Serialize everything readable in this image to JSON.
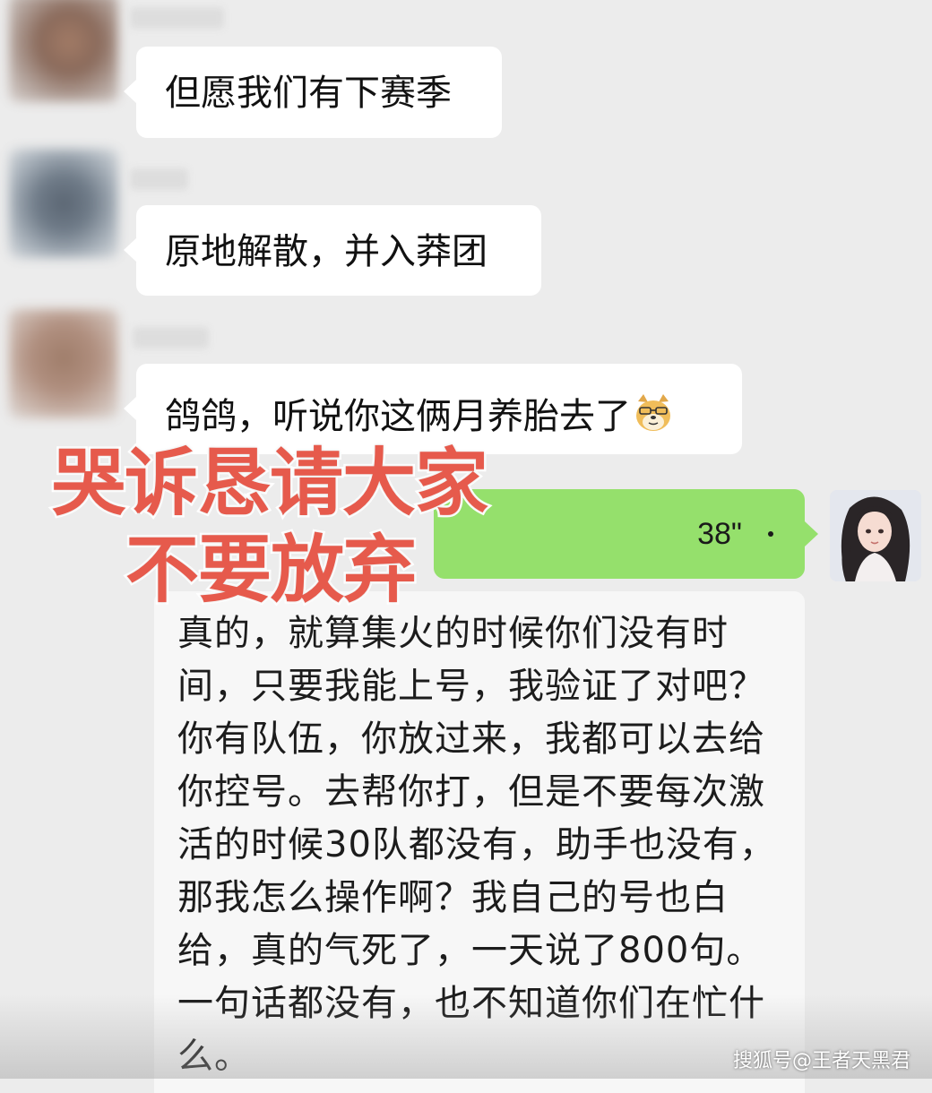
{
  "messages": [
    {
      "text": "但愿我们有下赛季"
    },
    {
      "text": "原地解散，并入莽团"
    },
    {
      "text": "鸽鸽，听说你这俩月养胎去了",
      "emoji": "doge-emoji-icon"
    }
  ],
  "voice": {
    "duration": "38\"",
    "icon": "voice-wave-icon"
  },
  "transcript": "真的，就算集火的时候你们没有时\n间，只要我能上号，我验证了对吧？\n你有队伍，你放过来，我都可以去给\n你控号。去帮你打，但是不要每次激\n活的时候30队都没有，助手也没有，\n那我怎么操作啊？我自己的号也白\n给，真的气死了，一天说了800句。\n一句话都没有，也不知道你们在忙什\n么。",
  "overlay": {
    "line1": "哭诉恳请大家",
    "line2": "不要放弃",
    "color": "#e65a4c"
  },
  "watermark": "搜狐号@王者天黑君",
  "colors": {
    "voice_bubble": "#95e06c",
    "background": "#ececec"
  }
}
